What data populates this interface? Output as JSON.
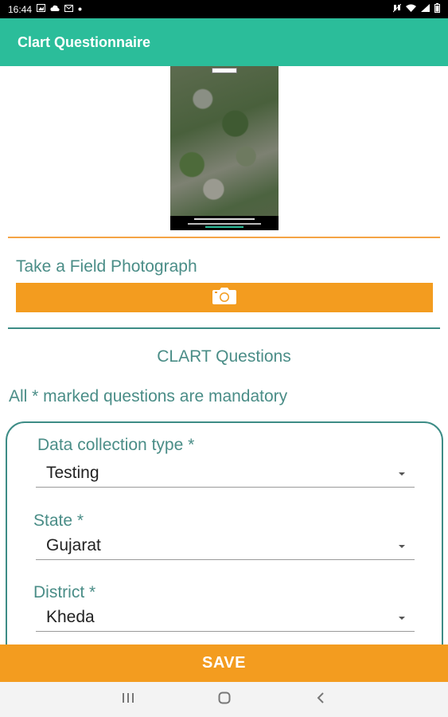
{
  "status_bar": {
    "time": "16:44",
    "left_icons": [
      "gallery-icon",
      "cloud-icon",
      "mail-icon",
      "dot-icon"
    ],
    "right_icons": [
      "mute-icon",
      "wifi-icon",
      "signal-icon",
      "battery-icon"
    ]
  },
  "app_bar": {
    "title": "Clart Questionnaire"
  },
  "photo_section": {
    "label": "Take a Field Photograph",
    "button_icon": "camera-icon"
  },
  "questions": {
    "title": "CLART Questions",
    "mandatory_note": "All * marked questions are mandatory"
  },
  "form": {
    "fields": [
      {
        "label": "Data collection type *",
        "value": "Testing"
      },
      {
        "label": "State *",
        "value": "Gujarat"
      },
      {
        "label": "District *",
        "value": "Kheda"
      }
    ]
  },
  "save_button": {
    "label": "SAVE"
  },
  "colors": {
    "primary": "#2bbd9a",
    "accent": "#f39c1f",
    "text_teal": "#4a8d87"
  }
}
